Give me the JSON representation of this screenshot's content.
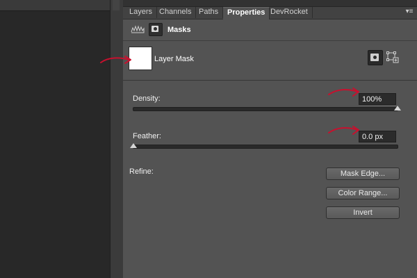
{
  "tabs": [
    {
      "label": "Layers",
      "active": false
    },
    {
      "label": "Channels",
      "active": false
    },
    {
      "label": "Paths",
      "active": false
    },
    {
      "label": "Properties",
      "active": true
    },
    {
      "label": "DevRocket",
      "active": false
    }
  ],
  "panel": {
    "title": "Masks",
    "menu_icon": "panel-menu-icon"
  },
  "layer": {
    "label": "Layer Mask",
    "thumbnail_color": "#ffffff"
  },
  "density": {
    "label": "Density:",
    "value": "100%",
    "slider_fraction": 1.0
  },
  "feather": {
    "label": "Feather:",
    "value": "0.0 px",
    "slider_fraction": 0.0
  },
  "refine": {
    "label": "Refine:",
    "buttons": {
      "mask_edge": "Mask Edge...",
      "color_range": "Color Range...",
      "invert": "Invert"
    }
  },
  "colors": {
    "panel_bg": "#535353",
    "canvas_bg": "#282828",
    "annotation_arrow": "#c8102e"
  }
}
